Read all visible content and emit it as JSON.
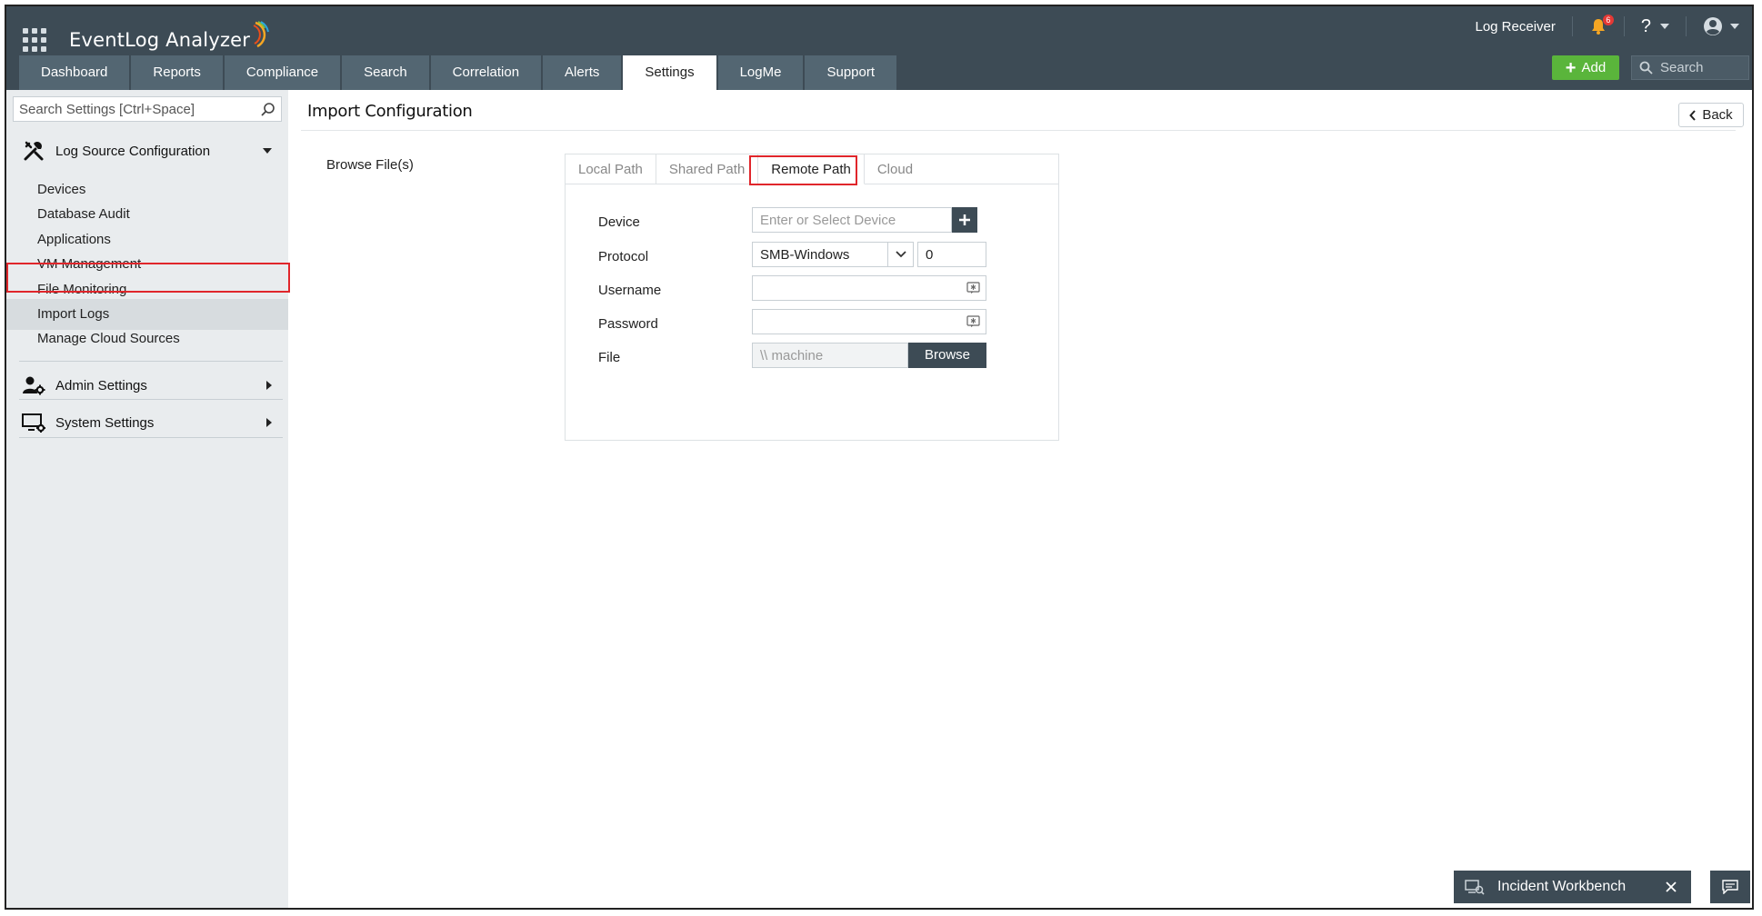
{
  "app": {
    "name": "EventLog Analyzer"
  },
  "header": {
    "log_receiver": "Log Receiver",
    "notification_count": "6",
    "help_label": "?",
    "add_label": "Add",
    "search_placeholder": "Search"
  },
  "nav": {
    "tabs": [
      {
        "label": "Dashboard"
      },
      {
        "label": "Reports"
      },
      {
        "label": "Compliance"
      },
      {
        "label": "Search"
      },
      {
        "label": "Correlation"
      },
      {
        "label": "Alerts"
      },
      {
        "label": "Settings"
      },
      {
        "label": "LogMe"
      },
      {
        "label": "Support"
      }
    ],
    "active": "Settings"
  },
  "sidebar": {
    "search_placeholder": "Search Settings [Ctrl+Space]",
    "sections": [
      {
        "label": "Log Source Configuration",
        "expanded": true,
        "items": [
          {
            "label": "Devices"
          },
          {
            "label": "Database Audit"
          },
          {
            "label": "Applications"
          },
          {
            "label": "VM Management"
          },
          {
            "label": "File Monitoring"
          },
          {
            "label": "Import Logs"
          },
          {
            "label": "Manage Cloud Sources"
          }
        ]
      },
      {
        "label": "Admin Settings",
        "expanded": false
      },
      {
        "label": "System Settings",
        "expanded": false
      }
    ],
    "active_item": "Import Logs"
  },
  "main": {
    "title": "Import Configuration",
    "back_label": "Back",
    "browse_label": "Browse File(s)",
    "source_tabs": [
      {
        "label": "Local Path"
      },
      {
        "label": "Shared Path"
      },
      {
        "label": "Remote Path"
      },
      {
        "label": "Cloud"
      }
    ],
    "active_tab": "Remote Path",
    "form": {
      "device_label": "Device",
      "device_placeholder": "Enter or Select Device",
      "protocol_label": "Protocol",
      "protocol_value": "SMB-Windows",
      "port_value": "0",
      "username_label": "Username",
      "username_value": "",
      "password_label": "Password",
      "password_value": "",
      "file_label": "File",
      "file_placeholder": "\\\\ machine",
      "browse_button": "Browse"
    }
  },
  "footer": {
    "incident_workbench": "Incident Workbench"
  },
  "colors": {
    "header_bg": "#3d4b55",
    "tab_bg": "#536672",
    "add_green": "#5ab53b",
    "highlight_red": "#e0262b",
    "sidebar_bg": "#e9ecee"
  }
}
